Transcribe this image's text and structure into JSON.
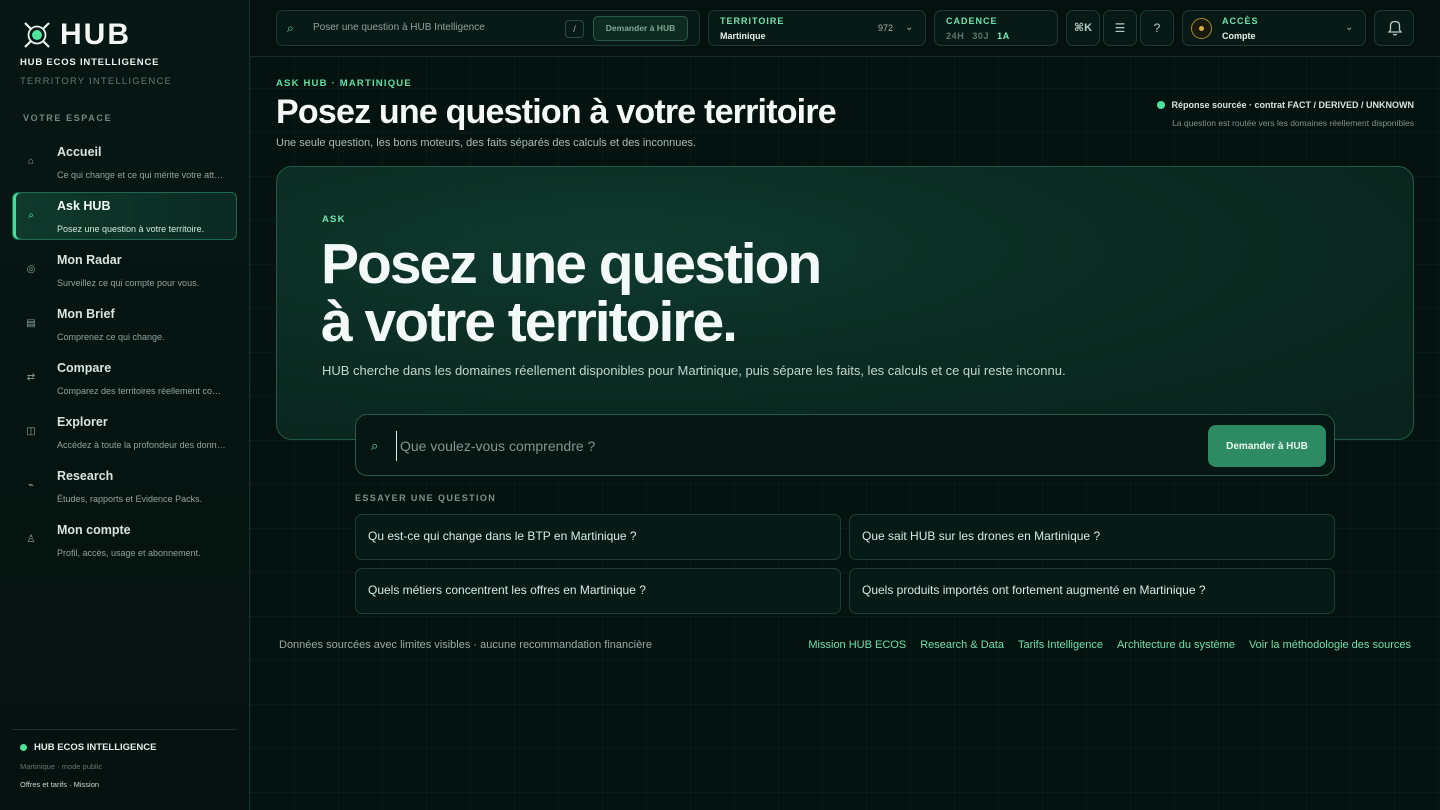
{
  "sidebar": {
    "logo_text": "HUB",
    "brand_name": "HUB ECOS INTELLIGENCE",
    "brand_sub": "TERRITORY INTELLIGENCE",
    "section_label": "VOTRE ESPACE",
    "items": [
      {
        "title": "Accueil",
        "desc": "Ce qui change et ce qui mérite votre attention.",
        "icon": "home-icon",
        "active": false
      },
      {
        "title": "Ask HUB",
        "desc": "Posez une question à votre territoire.",
        "icon": "search-icon",
        "active": true
      },
      {
        "title": "Mon Radar",
        "desc": "Surveillez ce qui compte pour vous.",
        "icon": "radar-icon",
        "active": false
      },
      {
        "title": "Mon Brief",
        "desc": "Comprenez ce qui change.",
        "icon": "brief-icon",
        "active": false
      },
      {
        "title": "Compare",
        "desc": "Comparez des territoires réellement comparables.",
        "icon": "compare-icon",
        "active": false
      },
      {
        "title": "Explorer",
        "desc": "Accédez à toute la profondeur des données.",
        "icon": "explorer-icon",
        "active": false
      },
      {
        "title": "Research",
        "desc": "Études, rapports et Evidence Packs.",
        "icon": "research-icon",
        "active": false
      },
      {
        "title": "Mon compte",
        "desc": "Profil, accès, usage et abonnement.",
        "icon": "account-icon",
        "active": false
      }
    ],
    "footer": {
      "title": "HUB ECOS INTELLIGENCE",
      "sub": "Martinique · mode public",
      "links": "Offres et tarifs · Mission"
    }
  },
  "topbar": {
    "search_placeholder": "Poser une question à HUB Intelligence",
    "search_kbd": "/",
    "search_button": "Demander à HUB",
    "territory_label": "TERRITOIRE",
    "territory_value": "Martinique",
    "territory_code": "972",
    "cadence_label": "CADENCE",
    "cadence_options": [
      "24H",
      "30J",
      "1A"
    ],
    "cadence_selected": "1A",
    "shortcut_label": "⌘K",
    "access_label": "ACCÈS",
    "access_value": "Compte"
  },
  "header": {
    "eyebrow": "ASK HUB · MARTINIQUE",
    "title": "Posez une question à votre territoire",
    "subtitle": "Une seule question, les bons moteurs, des faits séparés des calculs et des inconnues.",
    "status": "Réponse sourcée · contrat FACT / DERIVED / UNKNOWN",
    "status_sub": "La question est routée vers les domaines réellement disponibles"
  },
  "hero": {
    "eyebrow": "ASK",
    "title_line1": "Posez une question",
    "title_line2": "à votre territoire.",
    "description": "HUB cherche dans les domaines réellement disponibles pour Martinique, puis sépare les faits, les calculs et ce qui reste inconnu."
  },
  "ask": {
    "placeholder": "Que voulez-vous comprendre ?",
    "value": "",
    "button": "Demander à HUB",
    "try_label": "ESSAYER UNE QUESTION",
    "suggestions": [
      "Qu est-ce qui change dans le BTP en Martinique ?",
      "Que sait HUB sur les drones en Martinique ?",
      "Quels métiers concentrent les offres en Martinique ?",
      "Quels produits importés ont fortement augmenté en Martinique ?"
    ]
  },
  "footer": {
    "note": "Données sourcées avec limites visibles · aucune recommandation financière",
    "links": [
      "Mission HUB ECOS",
      "Research & Data",
      "Tarifs Intelligence",
      "Architecture du système",
      "Voir la méthodologie des sources"
    ]
  },
  "colors": {
    "accent": "#4ee39c",
    "background": "#04100c",
    "button": "#2d8a62"
  }
}
